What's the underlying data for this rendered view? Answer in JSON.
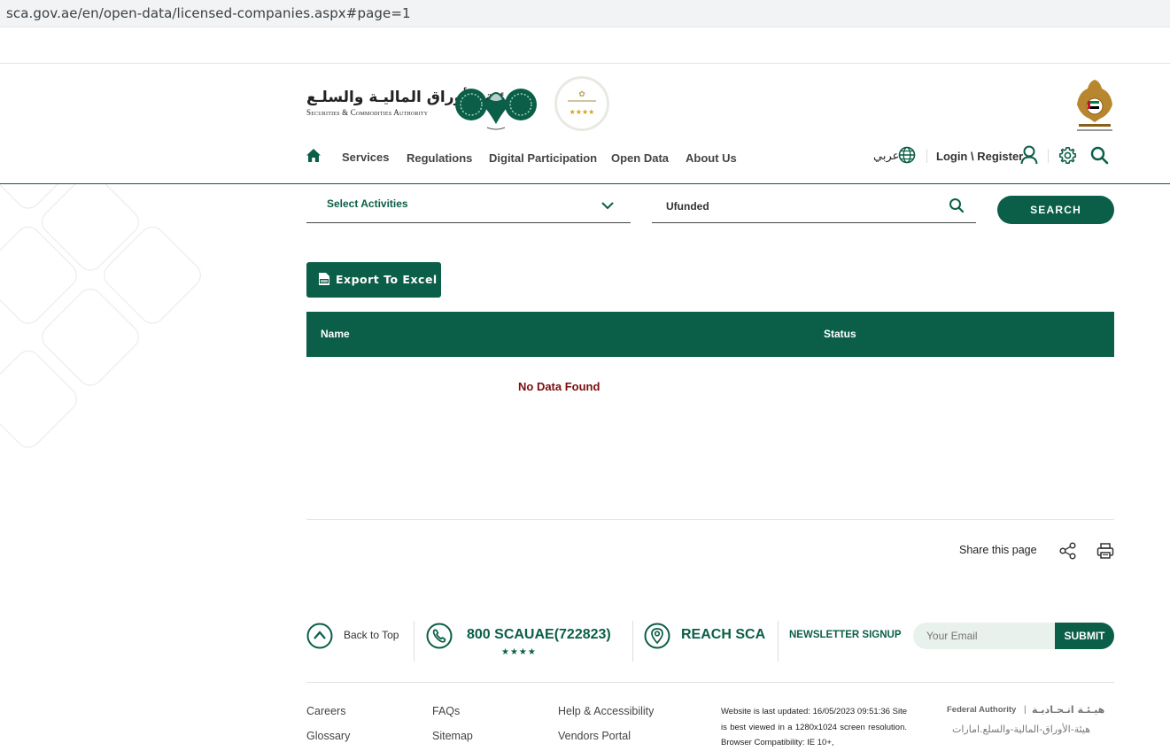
{
  "browser": {
    "url": "sca.gov.ae/en/open-data/licensed-companies.aspx#page=1"
  },
  "header": {
    "logo_arabic": "هيئـة الأوراق الماليـة والسلـع",
    "logo_english": "Securities & Commodities Authority",
    "nav": [
      {
        "label": "Services"
      },
      {
        "label": "Regulations"
      },
      {
        "label": "Digital Participation"
      },
      {
        "label": "Open Data"
      },
      {
        "label": "About Us"
      }
    ],
    "language_label": "عربي",
    "login_label": "Login \\ Register"
  },
  "filters": {
    "activities_label": "Select Activities",
    "search_value": "Ufunded",
    "search_button": "SEARCH"
  },
  "export_label": "Export To Excel",
  "table": {
    "columns": [
      "Name",
      "Status"
    ],
    "empty_message": "No Data Found"
  },
  "share": {
    "label": "Share this page"
  },
  "footer": {
    "back_to_top": "Back to Top",
    "phone": "800 SCAUAE(722823)",
    "phone_stars": "★★★★",
    "reach": "REACH SCA",
    "newsletter_label": "NEWSLETTER SIGNUP",
    "email_placeholder": "Your Email",
    "submit_label": "SUBMIT",
    "links": [
      "Careers",
      "FAQs",
      "Help & Accessibility",
      "Glossary",
      "Sitemap",
      "Vendors Portal"
    ],
    "updated_text": "Website is last updated: 16/05/2023 09:51:36 Site is best viewed in a 1280x1024 screen resolution. Browser Compatibility: IE 10+,",
    "federal_en": "Federal Authority",
    "federal_ar": "هيـئـة اتـحـاديـة",
    "federal_ar2": "هيئة-الأوراق-المالية-والسلع.امارات"
  },
  "colors": {
    "brand": "#0b5e47",
    "error": "#7b0e0e"
  }
}
